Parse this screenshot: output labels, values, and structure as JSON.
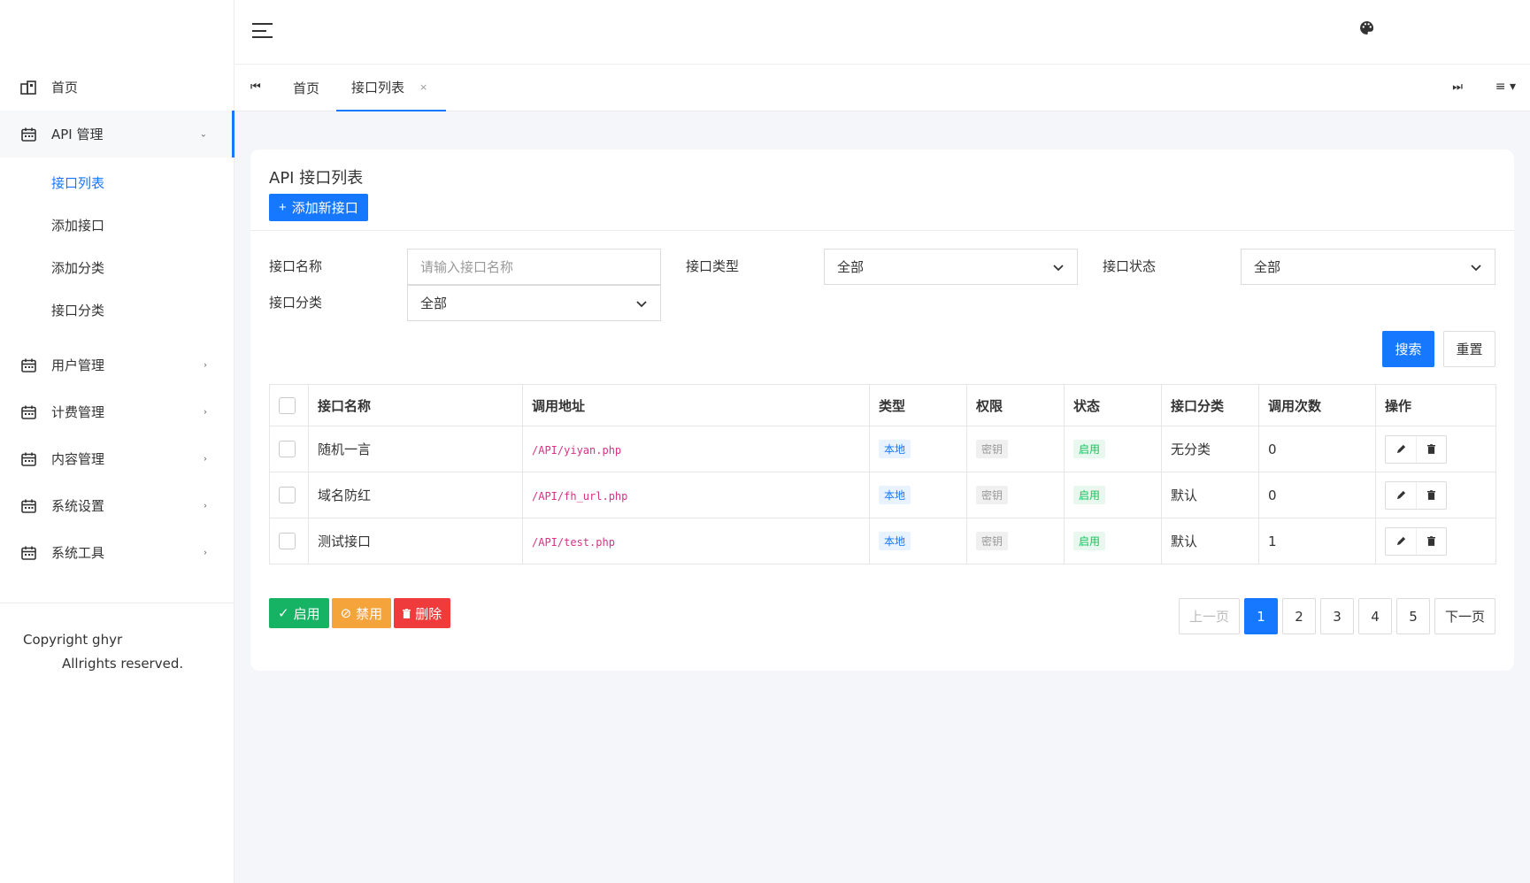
{
  "sidebar": {
    "home_label": "首页",
    "api_label": "API 管理",
    "sub_items": [
      "接口列表",
      "添加接口",
      "添加分类",
      "接口分类"
    ],
    "groups": [
      "用户管理",
      "计费管理",
      "内容管理",
      "系统设置",
      "系统工具"
    ],
    "copyright_1": "Copyright ghyr",
    "copyright_2": "All",
    "copyright_3": "rights reserved."
  },
  "tabs": {
    "home": "首页",
    "current": "接口列表",
    "close": "×"
  },
  "card": {
    "title": "API 接口列表",
    "add_label": "添加新接口",
    "add_icon": "+"
  },
  "filters": {
    "name_label": "接口名称",
    "name_placeholder": "请输入接口名称",
    "type_label": "接口类型",
    "type_value": "全部",
    "status_label": "接口状态",
    "status_value": "全部",
    "category_label": "接口分类",
    "category_value": "全部",
    "search_label": "搜索",
    "reset_label": "重置"
  },
  "table": {
    "headers": [
      "接口名称",
      "调用地址",
      "类型",
      "权限",
      "状态",
      "接口分类",
      "调用次数",
      "操作"
    ],
    "rows": [
      {
        "name": "随机一言",
        "url": "/API/yiyan.php",
        "type": "本地",
        "perm": "密钥",
        "status": "启用",
        "category": "无分类",
        "calls": "0"
      },
      {
        "name": "域名防红",
        "url": "/API/fh_url.php",
        "type": "本地",
        "perm": "密钥",
        "status": "启用",
        "category": "默认",
        "calls": "0"
      },
      {
        "name": "测试接口",
        "url": "/API/test.php",
        "type": "本地",
        "perm": "密钥",
        "status": "启用",
        "category": "默认",
        "calls": "1"
      }
    ]
  },
  "batch": {
    "enable": "启用",
    "disable": "禁用",
    "delete": "删除"
  },
  "pager": {
    "prev": "上一页",
    "pages": [
      "1",
      "2",
      "3",
      "4",
      "5"
    ],
    "next": "下一页"
  },
  "colors": {
    "primary": "#1677ff",
    "success": "#16b364",
    "warning": "#f5a33b",
    "danger": "#ef3b3b"
  }
}
